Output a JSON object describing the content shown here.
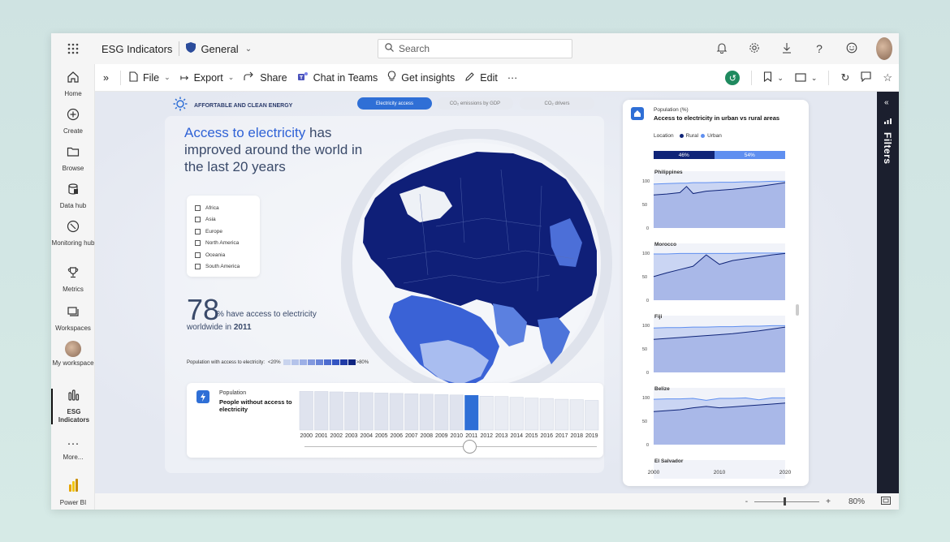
{
  "topbar": {
    "app_title": "ESG Indicators",
    "workspace": "General",
    "search_placeholder": "Search"
  },
  "nav": {
    "items": [
      {
        "label": "Home",
        "icon": "home-icon"
      },
      {
        "label": "Create",
        "icon": "plus-circle-icon"
      },
      {
        "label": "Browse",
        "icon": "folder-icon"
      },
      {
        "label": "Data hub",
        "icon": "database-icon"
      },
      {
        "label": "Monitoring hub",
        "icon": "monitoring-icon"
      },
      {
        "label": "Metrics",
        "icon": "trophy-icon"
      },
      {
        "label": "Workspaces",
        "icon": "workspaces-icon"
      },
      {
        "label": "My workspace",
        "icon": "avatar-icon"
      },
      {
        "label": "ESG Indicators",
        "icon": "report-icon"
      },
      {
        "label": "More...",
        "icon": "more-icon"
      },
      {
        "label": "Power BI",
        "icon": "powerbi-icon"
      }
    ]
  },
  "cmdbar": {
    "file": "File",
    "export": "Export",
    "share": "Share",
    "chat": "Chat in Teams",
    "insights": "Get insights",
    "edit": "Edit",
    "more": "···"
  },
  "filters_label": "Filters",
  "status": {
    "zoom_minus": "-",
    "zoom_plus": "+",
    "zoom_level": "80%"
  },
  "report": {
    "section": "AFFORTABLE AND CLEAN ENERGY",
    "tabs": [
      "Electricity access",
      "CO₂ emissions by GDP",
      "CO₂ drivers"
    ],
    "headline_highlight": "Access to electricity",
    "headline_rest": " has improved around the world in the last 20 years",
    "regions": [
      "Africa",
      "Asia",
      "Europe",
      "North America",
      "Oceania",
      "South America"
    ],
    "big_number": "78",
    "big_number_text": "% have access to electricity",
    "big_number_sub_pre": "worldwide in ",
    "big_number_year": "2011",
    "legend_label": "Population with access to electricity:",
    "legend_low": "<20%",
    "legend_high": ">80%",
    "legend_colors": [
      "#c9d4ee",
      "#b4c3ea",
      "#9db0e6",
      "#8299de",
      "#6a85d8",
      "#4d6ccf",
      "#3355c2",
      "#1f3aa6",
      "#0f2580"
    ],
    "population_label": "Population",
    "population_title": "People without access to electricity",
    "years": [
      "2000",
      "2001",
      "2002",
      "2003",
      "2004",
      "2005",
      "2006",
      "2007",
      "2008",
      "2009",
      "2010",
      "2011",
      "2012",
      "2013",
      "2014",
      "2015",
      "2016",
      "2017",
      "2018",
      "2019"
    ],
    "selected_year": "2011"
  },
  "right_panel": {
    "subtitle": "Population (%)",
    "title": "Access to electricity in urban vs rural areas",
    "location_label": "Location",
    "rural_label": "Rural",
    "urban_label": "Urban",
    "rural_pct": "46%",
    "urban_pct": "54%",
    "colors": {
      "rural": "#0f2478",
      "urban": "#5f8ff0",
      "area_rural": "#a9b8e8",
      "area_urban": "#cad5f3"
    }
  },
  "chart_data": [
    {
      "type": "bar",
      "title": "People without access to electricity",
      "categories": [
        "2000",
        "2001",
        "2002",
        "2003",
        "2004",
        "2005",
        "2006",
        "2007",
        "2008",
        "2009",
        "2010",
        "2011",
        "2012",
        "2013",
        "2014",
        "2015",
        "2016",
        "2017",
        "2018",
        "2019"
      ],
      "values": [
        100,
        99,
        98,
        97,
        96,
        95,
        94,
        93,
        92,
        91,
        90,
        89,
        87,
        86,
        84,
        82,
        81,
        79,
        78,
        76
      ],
      "highlight": "2011",
      "ylim": [
        0,
        100
      ]
    },
    {
      "type": "area",
      "title": "Access to electricity in urban vs rural areas",
      "x_ticks": [
        "2000",
        "2010",
        "2020"
      ],
      "y_ticks": [
        "100",
        "50",
        "0"
      ],
      "ylim": [
        0,
        110
      ],
      "xlim": [
        2000,
        2020
      ],
      "panels": [
        {
          "name": "Philippines",
          "x": [
            2000,
            2002,
            2004,
            2005,
            2006,
            2008,
            2010,
            2012,
            2014,
            2016,
            2018,
            2020
          ],
          "urban": [
            93,
            94,
            95,
            95,
            96,
            96,
            97,
            97,
            98,
            98,
            99,
            99
          ],
          "rural": [
            70,
            72,
            75,
            88,
            73,
            78,
            80,
            82,
            85,
            88,
            92,
            96
          ]
        },
        {
          "name": "Morocco",
          "x": [
            2000,
            2002,
            2004,
            2006,
            2008,
            2010,
            2012,
            2014,
            2016,
            2018,
            2020
          ],
          "urban": [
            98,
            98,
            99,
            99,
            99,
            99,
            99,
            100,
            100,
            100,
            100
          ],
          "rural": [
            50,
            58,
            65,
            72,
            96,
            76,
            84,
            88,
            92,
            96,
            99
          ]
        },
        {
          "name": "Fiji",
          "x": [
            2000,
            2002,
            2004,
            2006,
            2008,
            2010,
            2012,
            2014,
            2016,
            2018,
            2020
          ],
          "urban": [
            94,
            95,
            95,
            96,
            96,
            97,
            97,
            98,
            98,
            99,
            99
          ],
          "rural": [
            70,
            72,
            74,
            76,
            78,
            80,
            82,
            85,
            88,
            92,
            96
          ]
        },
        {
          "name": "Belize",
          "x": [
            2000,
            2002,
            2004,
            2006,
            2008,
            2010,
            2012,
            2014,
            2016,
            2018,
            2020
          ],
          "urban": [
            96,
            97,
            97,
            98,
            94,
            98,
            98,
            99,
            95,
            99,
            99
          ],
          "rural": [
            70,
            72,
            74,
            78,
            81,
            78,
            80,
            82,
            84,
            86,
            88
          ]
        },
        {
          "name": "El Salvador",
          "x": [
            2000,
            2020
          ],
          "urban": [],
          "rural": []
        }
      ]
    }
  ]
}
